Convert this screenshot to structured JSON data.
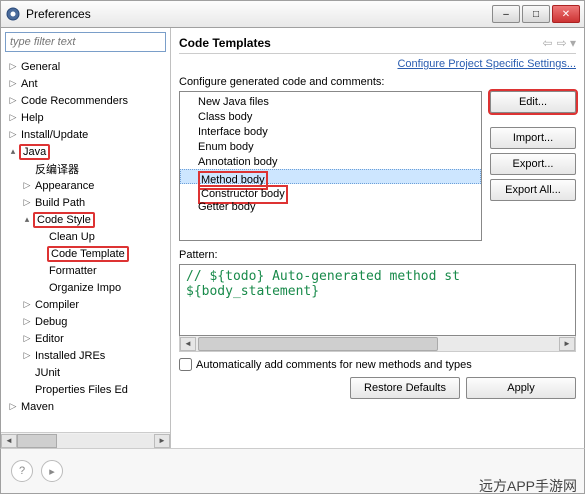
{
  "window": {
    "title": "Preferences"
  },
  "filter": {
    "placeholder": "type filter text"
  },
  "tree": {
    "items": [
      {
        "label": "General",
        "exp": "▷",
        "depth": 0
      },
      {
        "label": "Ant",
        "exp": "▷",
        "depth": 0
      },
      {
        "label": "Code Recommenders",
        "exp": "▷",
        "depth": 0
      },
      {
        "label": "Help",
        "exp": "▷",
        "depth": 0
      },
      {
        "label": "Install/Update",
        "exp": "▷",
        "depth": 0
      },
      {
        "label": "Java",
        "exp": "▴",
        "depth": 0,
        "hl": true
      },
      {
        "label": "反编译器",
        "exp": "",
        "depth": 1
      },
      {
        "label": "Appearance",
        "exp": "▷",
        "depth": 1
      },
      {
        "label": "Build Path",
        "exp": "▷",
        "depth": 1
      },
      {
        "label": "Code Style",
        "exp": "▴",
        "depth": 1,
        "hl": true
      },
      {
        "label": "Clean Up",
        "exp": "",
        "depth": 2
      },
      {
        "label": "Code Template",
        "exp": "",
        "depth": 2,
        "hl": true
      },
      {
        "label": "Formatter",
        "exp": "",
        "depth": 2
      },
      {
        "label": "Organize Impo",
        "exp": "",
        "depth": 2
      },
      {
        "label": "Compiler",
        "exp": "▷",
        "depth": 1
      },
      {
        "label": "Debug",
        "exp": "▷",
        "depth": 1
      },
      {
        "label": "Editor",
        "exp": "▷",
        "depth": 1
      },
      {
        "label": "Installed JREs",
        "exp": "▷",
        "depth": 1
      },
      {
        "label": "JUnit",
        "exp": "",
        "depth": 1
      },
      {
        "label": "Properties Files Ed",
        "exp": "",
        "depth": 1
      },
      {
        "label": "Maven",
        "exp": "▷",
        "depth": 0
      }
    ]
  },
  "page": {
    "heading": "Code Templates",
    "link": "Configure Project Specific Settings...",
    "configLabel": "Configure generated code and comments:",
    "listItems": [
      {
        "label": "New Java files"
      },
      {
        "label": "Class body"
      },
      {
        "label": "Interface body"
      },
      {
        "label": "Enum body"
      },
      {
        "label": "Annotation body"
      },
      {
        "label": "Method body",
        "selected": true,
        "hl": true
      },
      {
        "label": "Constructor body",
        "hl": true
      },
      {
        "label": "Getter body"
      }
    ],
    "buttons": {
      "edit": "Edit...",
      "import": "Import...",
      "export": "Export...",
      "exportAll": "Export All..."
    },
    "patternLabel": "Pattern:",
    "pattern": "// ${todo} Auto-generated method st\n${body_statement}",
    "autoCheckbox": "Automatically add comments for new methods and types",
    "restore": "Restore Defaults",
    "apply": "Apply"
  },
  "watermark": "远方APP手游网"
}
